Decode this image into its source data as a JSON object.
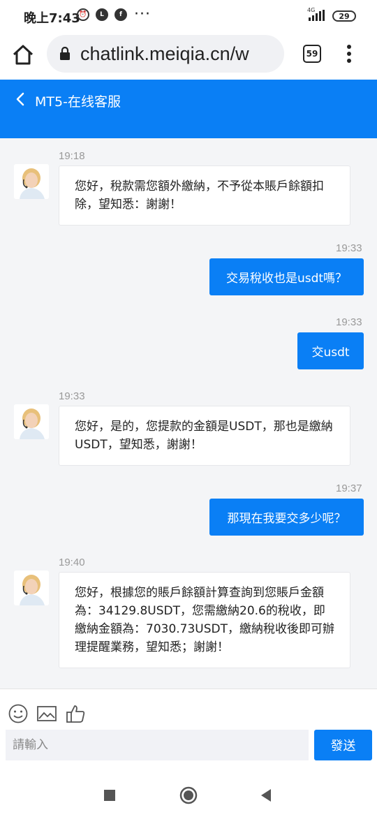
{
  "status_bar": {
    "time": "晚上7:43",
    "network": "4G",
    "battery": "29"
  },
  "browser": {
    "url": "chatlink.meiqia.cn/w",
    "tab_count": "59"
  },
  "chat": {
    "title": "MT5-在线客服",
    "accent_color": "#0a7ff5",
    "messages": [
      {
        "direction": "in",
        "time": "19:18",
        "text": "您好，稅款需您額外繳納，不予從本賬戶餘額扣除，望知悉：謝謝！"
      },
      {
        "direction": "out",
        "time": "19:33",
        "text": "交易稅收也是usdt嗎？"
      },
      {
        "direction": "out",
        "time": "19:33",
        "text": "交usdt"
      },
      {
        "direction": "in",
        "time": "19:33",
        "text": "您好，是的，您提款的金額是USDT，那也是繳納USDT，望知悉，謝謝！"
      },
      {
        "direction": "out",
        "time": "19:37",
        "text": "那現在我要交多少呢？"
      },
      {
        "direction": "in",
        "time": "19:40",
        "text": "您好，根據您的賬戶餘額計算查詢到您賬戶金額為：34129.8USDT，您需繳納20.6的稅收，即繳納金額為：7030.73USDT，繳納稅收後即可辦理提醒業務，望知悉；謝謝！"
      }
    ]
  },
  "composer": {
    "placeholder": "請輸入",
    "send_label": "發送"
  }
}
